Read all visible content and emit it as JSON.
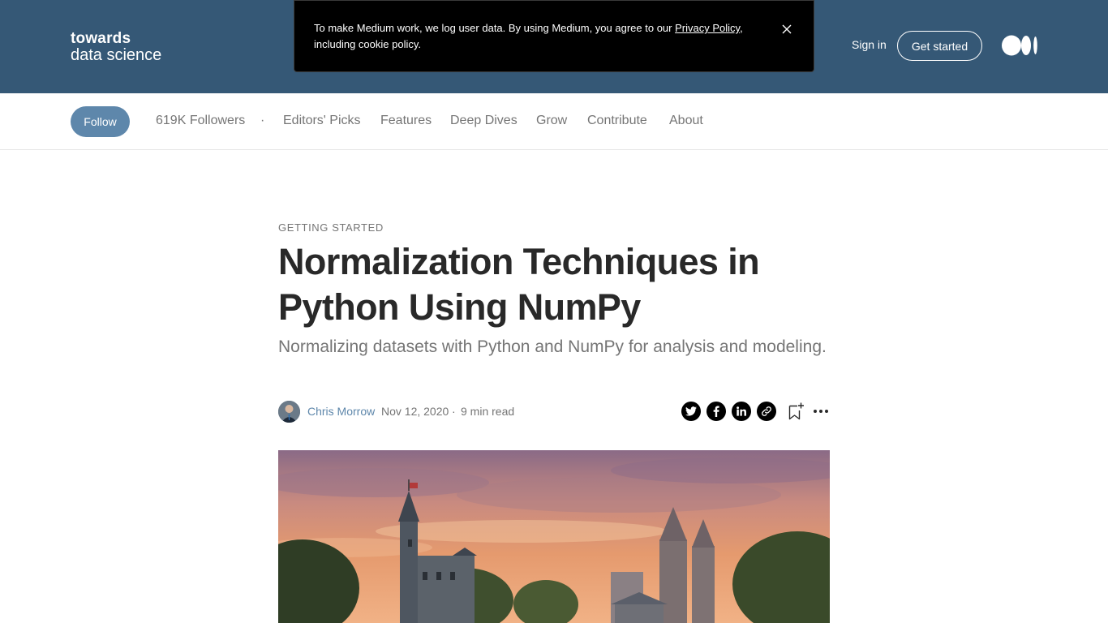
{
  "brand": {
    "line1": "towards",
    "line2": "data science"
  },
  "cookie_banner": {
    "text_before": "To make Medium work, we log user data. By using Medium, you agree to our ",
    "link": "Privacy Policy",
    "text_after": ", including cookie policy."
  },
  "header": {
    "signin_label": "Sign in",
    "get_started_label": "Get started"
  },
  "subnav": {
    "follow_label": "Follow",
    "followers": "619K Followers",
    "separator": "·",
    "items": [
      "Editors' Picks",
      "Features",
      "Deep Dives",
      "Grow",
      "Contribute",
      "About"
    ]
  },
  "article": {
    "kicker": "GETTING STARTED",
    "title": "Normalization Techniques in Python Using NumPy",
    "subtitle": "Normalizing datasets with Python and NumPy for analysis and modeling.",
    "author": "Chris Morrow",
    "date": "Nov 12, 2020",
    "separator": "·",
    "read_time": "9 min read"
  },
  "share_icons": [
    "twitter-icon",
    "facebook-icon",
    "linkedin-icon",
    "link-icon"
  ],
  "colors": {
    "header_bg": "#355876",
    "follow_bg": "#5e87ab",
    "author_link": "#5e87ab"
  }
}
